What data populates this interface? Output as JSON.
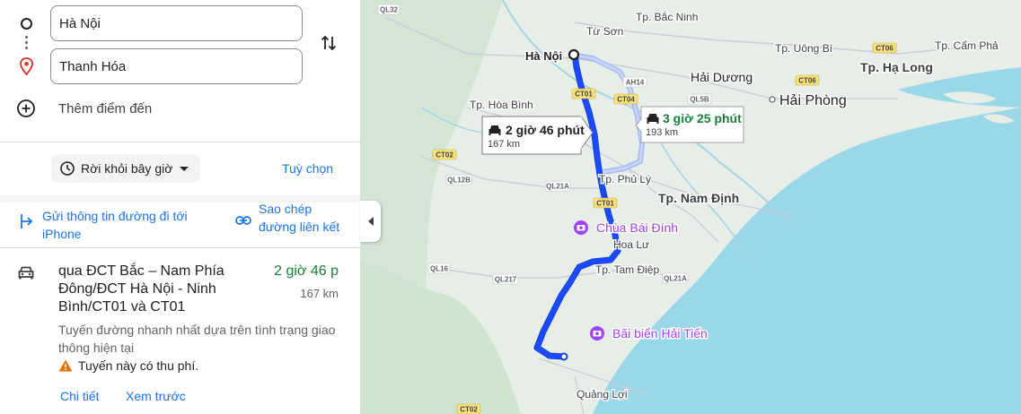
{
  "directions": {
    "origin": "Hà Nội",
    "destination": "Thanh Hóa",
    "add_stop": "Thêm điểm đến",
    "depart_label": "Rời khỏi bây giờ",
    "options_label": "Tuỳ chọn",
    "send_to_phone": "Gửi thông tin đường đi tới iPhone",
    "copy_link": "Sao chép đường liên kết"
  },
  "route": {
    "via": "qua ĐCT Bắc – Nam Phía Đông/ĐCT Hà Nội - Ninh Bình/CT01 và CT01",
    "duration": "2 giờ 46 p",
    "distance": "167 km",
    "description": "Tuyến đường nhanh nhất dựa trên tình trạng giao thông hiện tại",
    "toll_warning": "Tuyến này có thu phí.",
    "details_link": "Chi tiết",
    "preview_link": "Xem trước"
  },
  "map": {
    "callout_primary": {
      "duration": "2 giờ 46 phút",
      "distance": "167 km"
    },
    "callout_alt": {
      "duration": "3 giờ 25 phút",
      "distance": "193 km"
    },
    "places": {
      "ha_noi": "Hà Nội",
      "hai_phong": "Hải Phòng",
      "bac_ninh": "Tp. Bắc Ninh",
      "tu_son": "Từ Sơn",
      "uong_bi": "Tp. Uông Bí",
      "cam_pha": "Tp. Cẩm Phả",
      "ha_long": "Tp. Hạ Long",
      "hai_duong": "Hải Dương",
      "hoa_binh": "Tp. Hòa Bình",
      "phu_ly": "Tp. Phủ Lý",
      "nam_dinh": "Tp. Nam Định",
      "chua_bai_dinh": "Chùa Bái Đính",
      "hoa_lu": "Hoa Lư",
      "tam_diep": "Tp. Tam Điệp",
      "bai_bien_hai_tien": "Bãi biển Hải Tiến",
      "quang_loi": "Quảng Lợi"
    },
    "road_labels": {
      "ql32": "QL32",
      "ql12b": "QL12B",
      "ql21a_1": "QL21A",
      "ql21a_2": "QL21A",
      "ql16": "QL16",
      "ql217": "QL217",
      "ql5b": "QL5B",
      "ct02_1": "CT02",
      "ct02_2": "CT02",
      "ct01_1": "CT01",
      "ct01_2": "CT01",
      "ct04": "CT04",
      "ct06_1": "CT06",
      "ct06_2": "CT06",
      "ah14": "AH14"
    },
    "colors": {
      "route": "#1a4bff",
      "alt_route": "#a7b9f5",
      "land": "#e6eee7",
      "water": "#9ad7e8",
      "duration_green": "#188038",
      "link_blue": "#1a73e8",
      "poi_purple": "#a142f4"
    }
  }
}
